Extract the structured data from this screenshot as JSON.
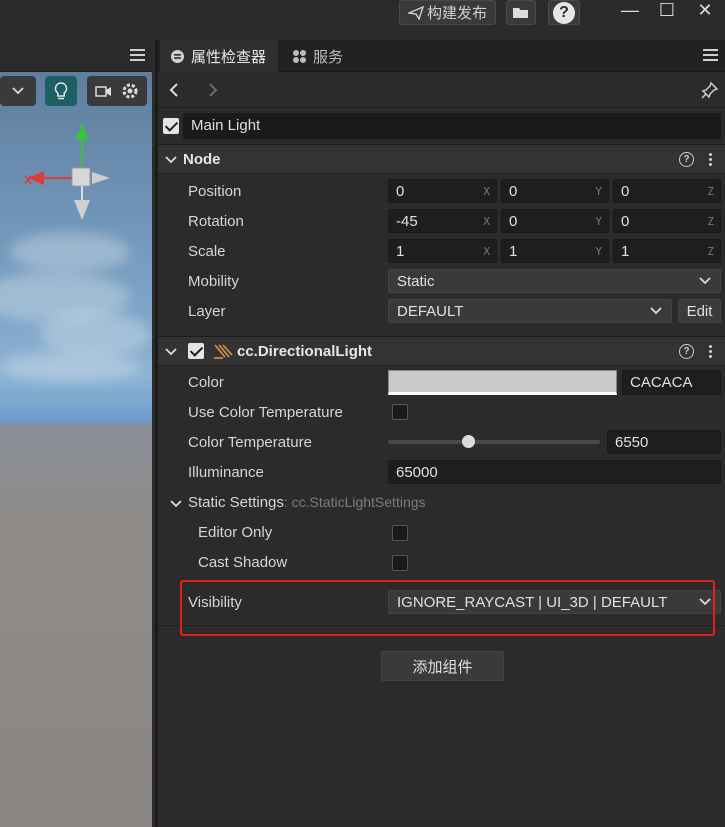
{
  "titlebar": {
    "build_label": "构建发布",
    "help_glyph": "?",
    "minimize_glyph": "—",
    "maximize_glyph": "☐",
    "close_glyph": "✕"
  },
  "inspector": {
    "tabs": [
      {
        "label": "属性检查器",
        "icon": "inspector-icon",
        "active": true
      },
      {
        "label": "服务",
        "icon": "services-icon",
        "active": false
      }
    ],
    "node_name": "Main Light",
    "node_enabled": true
  },
  "node_section": {
    "title": "Node",
    "properties": {
      "position": {
        "label": "Position",
        "x": "0",
        "y": "0",
        "z": "0"
      },
      "rotation": {
        "label": "Rotation",
        "x": "-45",
        "y": "0",
        "z": "0"
      },
      "scale": {
        "label": "Scale",
        "x": "1",
        "y": "1",
        "z": "1"
      },
      "mobility": {
        "label": "Mobility",
        "value": "Static"
      },
      "layer": {
        "label": "Layer",
        "value": "DEFAULT",
        "edit_label": "Edit"
      }
    },
    "axis_labels": {
      "x": "X",
      "y": "Y",
      "z": "Z"
    }
  },
  "light_section": {
    "title": "cc.DirectionalLight",
    "enabled": true,
    "color": {
      "label": "Color",
      "hex": "CACACA",
      "swatch": "#cacaca"
    },
    "use_color_temperature": {
      "label": "Use Color Temperature",
      "checked": false
    },
    "color_temperature": {
      "label": "Color Temperature",
      "value": "6550",
      "slider_fraction": 0.38
    },
    "illuminance": {
      "label": "Illuminance",
      "value": "65000"
    },
    "static_settings": {
      "label": "Static Settings",
      "type_hint": ": cc.StaticLightSettings",
      "editor_only": {
        "label": "Editor Only",
        "checked": false
      },
      "cast_shadow": {
        "label": "Cast Shadow",
        "checked": false
      }
    },
    "visibility": {
      "label": "Visibility",
      "value": "IGNORE_RAYCAST | UI_3D | DEFAULT"
    }
  },
  "add_component_label": "添加组件",
  "colors": {
    "accent_teal": "#1e5f66",
    "highlight_red": "#e0201c",
    "gizmo_green": "#3cc13c",
    "gizmo_red": "#e03a3a"
  }
}
